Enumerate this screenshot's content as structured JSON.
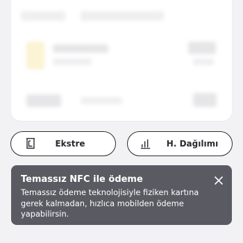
{
  "actions": {
    "statement_label": "Ekstre",
    "distribution_label": "H. Dağılımı",
    "statement_icon": "statement-icon",
    "distribution_icon": "bar-chart-icon"
  },
  "toast": {
    "title": "Temassız NFC ile ödeme",
    "body": "Temassız ödeme teknolojisiyle fiziken kartına gerek kalmadan, hızlıca mobilden ödeme yapabilirsin.",
    "close_icon": "close-icon",
    "background": "#5a5a62"
  },
  "colors": {
    "page_bg": "#f2f2f4",
    "button_border": "#2a2a2e"
  }
}
